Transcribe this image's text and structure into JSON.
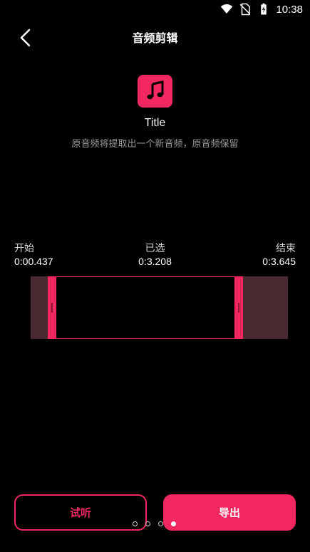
{
  "status": {
    "time": "10:38"
  },
  "header": {
    "title": "音频剪辑"
  },
  "track": {
    "icon": "music-note-icon",
    "title": "Title",
    "hint": "原音频将提取出一个新音频，原音频保留"
  },
  "range": {
    "start_label": "开始",
    "start_value": "0:00.437",
    "selected_label": "已选",
    "selected_value": "0:3.208",
    "end_label": "结束",
    "end_value": "0:3.645"
  },
  "actions": {
    "preview_label": "试听",
    "export_label": "导出"
  },
  "pager": {
    "count": 4,
    "active_index": 3
  },
  "colors": {
    "accent": "#f2275f",
    "background": "#000000",
    "track": "#4a2a31"
  }
}
